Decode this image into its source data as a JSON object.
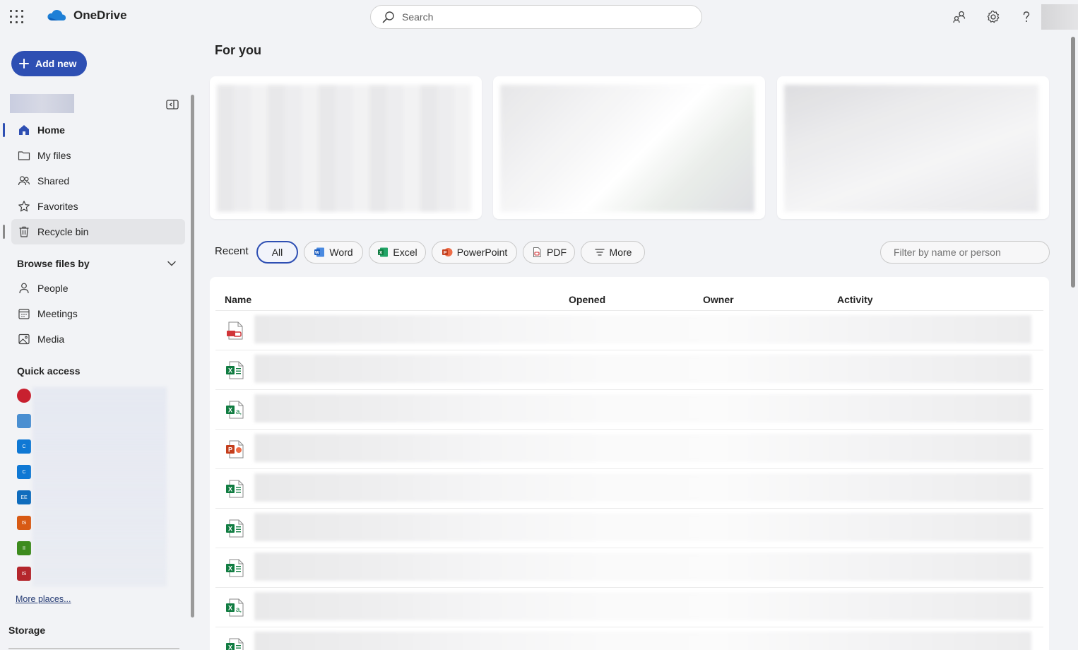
{
  "app": {
    "name": "OneDrive"
  },
  "search": {
    "placeholder": "Search"
  },
  "colors": {
    "accent": "#2e4fb3",
    "excel": "#107c41",
    "word": "#185abd",
    "powerpoint": "#c43e1c",
    "pdf": "#d13438"
  },
  "nav": {
    "add_new": "Add new",
    "items": [
      {
        "label": "Home",
        "icon": "home-icon"
      },
      {
        "label": "My files",
        "icon": "folder-icon"
      },
      {
        "label": "Shared",
        "icon": "people-icon"
      },
      {
        "label": "Favorites",
        "icon": "star-icon"
      },
      {
        "label": "Recycle bin",
        "icon": "trash-icon"
      }
    ],
    "browse_title": "Browse files by",
    "browse_items": [
      {
        "label": "People",
        "icon": "person-icon"
      },
      {
        "label": "Meetings",
        "icon": "calendar-icon"
      },
      {
        "label": "Media",
        "icon": "image-icon"
      }
    ],
    "quick_access_title": "Quick access",
    "quick_access_icons": [
      {
        "initials": "",
        "color": "#c8202f"
      },
      {
        "initials": "",
        "color": "#4a8fd1"
      },
      {
        "initials": "C",
        "color": "#0f78d4"
      },
      {
        "initials": "C",
        "color": "#0f78d4"
      },
      {
        "initials": "EE",
        "color": "#0f6cbd"
      },
      {
        "initials": "IS",
        "color": "#d85a14"
      },
      {
        "initials": "II",
        "color": "#3d8b1e"
      },
      {
        "initials": "IS",
        "color": "#b4262c"
      }
    ],
    "more_places": "More places...",
    "storage": "Storage"
  },
  "main": {
    "for_you": "For you",
    "recent_label": "Recent",
    "filters": [
      "All",
      "Word",
      "Excel",
      "PowerPoint",
      "PDF",
      "More"
    ],
    "filter_placeholder": "Filter by name or person",
    "columns": [
      "Name",
      "Opened",
      "Owner",
      "Activity"
    ],
    "rows": [
      {
        "type": "pdf"
      },
      {
        "type": "excel"
      },
      {
        "type": "excel-form"
      },
      {
        "type": "powerpoint"
      },
      {
        "type": "excel"
      },
      {
        "type": "excel"
      },
      {
        "type": "excel"
      },
      {
        "type": "excel-form"
      },
      {
        "type": "excel"
      }
    ]
  }
}
